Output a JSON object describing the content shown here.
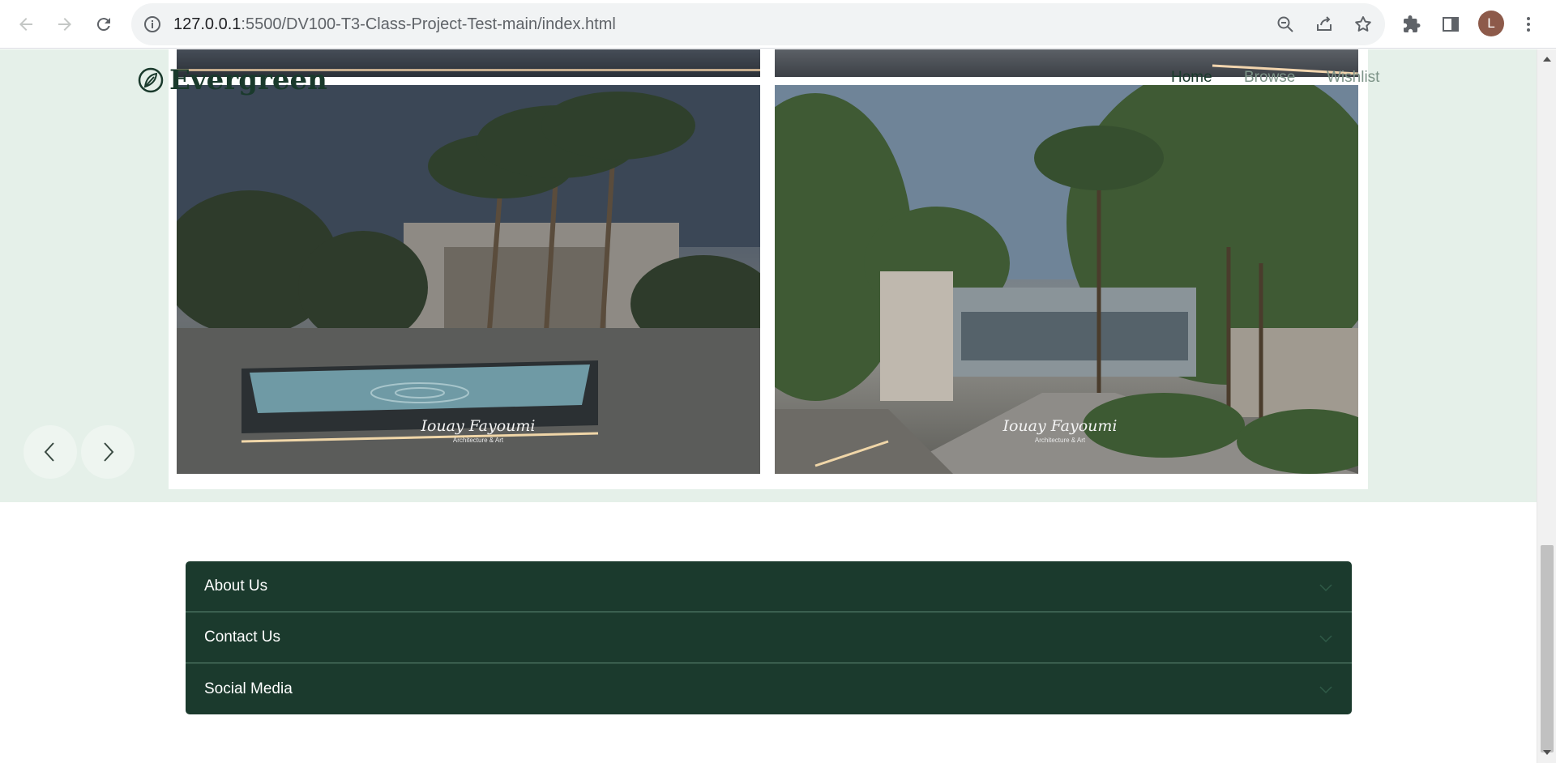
{
  "browser": {
    "url_host": "127.0.0.1",
    "url_rest": ":5500/DV100-T3-Class-Project-Test-main/index.html",
    "profile_initial": "L",
    "icons": [
      "back-icon",
      "forward-icon",
      "reload-icon",
      "info-icon",
      "zoom-out-icon",
      "share-icon",
      "star-icon",
      "extensions-icon",
      "side-panel-icon",
      "more-icon"
    ]
  },
  "site": {
    "brand": "Evergreen",
    "nav": [
      {
        "label": "Home"
      },
      {
        "label": "Browse"
      },
      {
        "label": "Wishlist"
      }
    ]
  },
  "gallery": {
    "signature_name": "Iouay Fayoumi",
    "signature_sub": "Architecture & Art"
  },
  "accordion": {
    "items": [
      {
        "label": "About Us"
      },
      {
        "label": "Contact Us"
      },
      {
        "label": "Social Media"
      }
    ]
  },
  "colors": {
    "hero_bg": "#e5f0e9",
    "accent": "#1b3a2d",
    "nav_text": "#5a7063"
  }
}
